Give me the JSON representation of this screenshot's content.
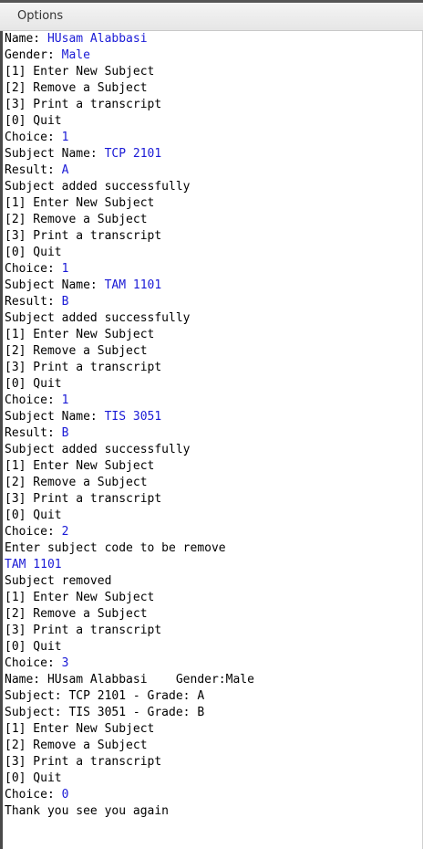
{
  "window": {
    "title": "Options"
  },
  "colors": {
    "output_text": "#000000",
    "user_input_text": "#1a1ad6"
  },
  "console": {
    "lines": [
      {
        "prompt": "Name: ",
        "input": "HUsam Alabbasi"
      },
      {
        "prompt": "Gender: ",
        "input": "Male"
      },
      {
        "prompt": "[1] Enter New Subject",
        "input": ""
      },
      {
        "prompt": "[2] Remove a Subject",
        "input": ""
      },
      {
        "prompt": "[3] Print a transcript",
        "input": ""
      },
      {
        "prompt": "[0] Quit",
        "input": ""
      },
      {
        "prompt": "Choice: ",
        "input": "1"
      },
      {
        "prompt": "Subject Name: ",
        "input": "TCP 2101"
      },
      {
        "prompt": "Result: ",
        "input": "A"
      },
      {
        "prompt": "Subject added successfully",
        "input": ""
      },
      {
        "prompt": "[1] Enter New Subject",
        "input": ""
      },
      {
        "prompt": "[2] Remove a Subject",
        "input": ""
      },
      {
        "prompt": "[3] Print a transcript",
        "input": ""
      },
      {
        "prompt": "[0] Quit",
        "input": ""
      },
      {
        "prompt": "Choice: ",
        "input": "1"
      },
      {
        "prompt": "Subject Name: ",
        "input": "TAM 1101"
      },
      {
        "prompt": "Result: ",
        "input": "B"
      },
      {
        "prompt": "Subject added successfully",
        "input": ""
      },
      {
        "prompt": "[1] Enter New Subject",
        "input": ""
      },
      {
        "prompt": "[2] Remove a Subject",
        "input": ""
      },
      {
        "prompt": "[3] Print a transcript",
        "input": ""
      },
      {
        "prompt": "[0] Quit",
        "input": ""
      },
      {
        "prompt": "Choice: ",
        "input": "1"
      },
      {
        "prompt": "Subject Name: ",
        "input": "TIS 3051"
      },
      {
        "prompt": "Result: ",
        "input": "B"
      },
      {
        "prompt": "Subject added successfully",
        "input": ""
      },
      {
        "prompt": "[1] Enter New Subject",
        "input": ""
      },
      {
        "prompt": "[2] Remove a Subject",
        "input": ""
      },
      {
        "prompt": "[3] Print a transcript",
        "input": ""
      },
      {
        "prompt": "[0] Quit",
        "input": ""
      },
      {
        "prompt": "Choice: ",
        "input": "2"
      },
      {
        "prompt": "Enter subject code to be remove",
        "input": ""
      },
      {
        "prompt": "",
        "input": "TAM 1101"
      },
      {
        "prompt": "Subject removed",
        "input": ""
      },
      {
        "prompt": "[1] Enter New Subject",
        "input": ""
      },
      {
        "prompt": "[2] Remove a Subject",
        "input": ""
      },
      {
        "prompt": "[3] Print a transcript",
        "input": ""
      },
      {
        "prompt": "[0] Quit",
        "input": ""
      },
      {
        "prompt": "Choice: ",
        "input": "3"
      },
      {
        "prompt": "Name: HUsam Alabbasi    Gender:Male",
        "input": ""
      },
      {
        "prompt": "Subject: TCP 2101 - Grade: A",
        "input": ""
      },
      {
        "prompt": "Subject: TIS 3051 - Grade: B",
        "input": ""
      },
      {
        "prompt": "[1] Enter New Subject",
        "input": ""
      },
      {
        "prompt": "[2] Remove a Subject",
        "input": ""
      },
      {
        "prompt": "[3] Print a transcript",
        "input": ""
      },
      {
        "prompt": "[0] Quit",
        "input": ""
      },
      {
        "prompt": "Choice: ",
        "input": "0"
      },
      {
        "prompt": "Thank you see you again",
        "input": ""
      }
    ]
  }
}
